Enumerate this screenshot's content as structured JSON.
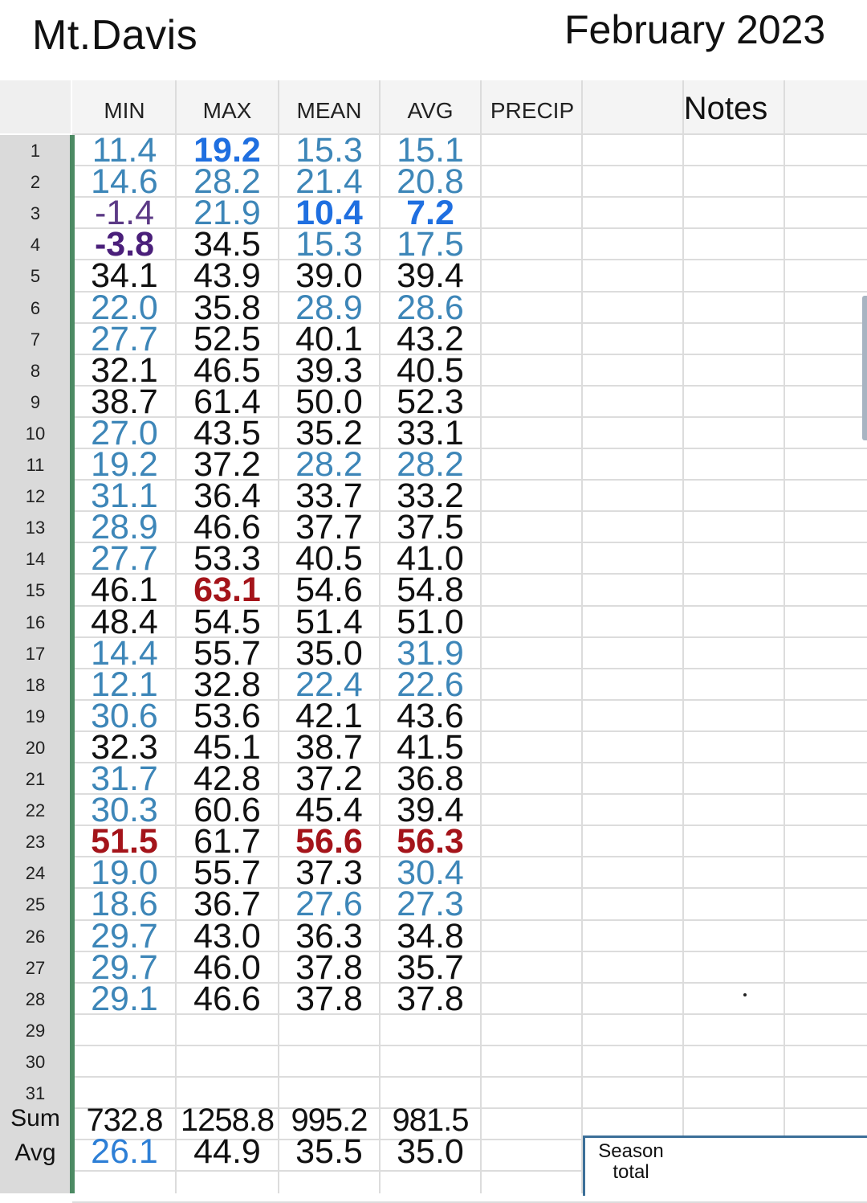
{
  "location": "Mt.Davis",
  "month": "February 2023",
  "columns": [
    "MIN",
    "MAX",
    "MEAN",
    "AVG",
    "PRECIP"
  ],
  "notes_header": "Notes",
  "row_numbers": [
    "1",
    "2",
    "3",
    "4",
    "5",
    "6",
    "7",
    "8",
    "9",
    "10",
    "11",
    "12",
    "13",
    "14",
    "15",
    "16",
    "17",
    "18",
    "19",
    "20",
    "21",
    "22",
    "23",
    "24",
    "25",
    "26",
    "27",
    "28",
    "29",
    "30",
    "31"
  ],
  "rows": [
    [
      [
        "11.4",
        "lblue"
      ],
      [
        "19.2",
        "bblue"
      ],
      [
        "15.3",
        "lblue"
      ],
      [
        "15.1",
        "lblue"
      ]
    ],
    [
      [
        "14.6",
        "lblue"
      ],
      [
        "28.2",
        "lblue"
      ],
      [
        "21.4",
        "lblue"
      ],
      [
        "20.8",
        "lblue"
      ]
    ],
    [
      [
        "-1.4",
        "lpurple"
      ],
      [
        "21.9",
        "lblue"
      ],
      [
        "10.4",
        "bblue"
      ],
      [
        "7.2",
        "bblue"
      ]
    ],
    [
      [
        "-3.8",
        "dpurple"
      ],
      [
        "34.5",
        "black"
      ],
      [
        "15.3",
        "lblue"
      ],
      [
        "17.5",
        "lblue"
      ]
    ],
    [
      [
        "34.1",
        "black"
      ],
      [
        "43.9",
        "black"
      ],
      [
        "39.0",
        "black"
      ],
      [
        "39.4",
        "black"
      ]
    ],
    [
      [
        "22.0",
        "lblue"
      ],
      [
        "35.8",
        "black"
      ],
      [
        "28.9",
        "lblue"
      ],
      [
        "28.6",
        "lblue"
      ]
    ],
    [
      [
        "27.7",
        "lblue"
      ],
      [
        "52.5",
        "black"
      ],
      [
        "40.1",
        "black"
      ],
      [
        "43.2",
        "black"
      ]
    ],
    [
      [
        "32.1",
        "black"
      ],
      [
        "46.5",
        "black"
      ],
      [
        "39.3",
        "black"
      ],
      [
        "40.5",
        "black"
      ]
    ],
    [
      [
        "38.7",
        "black"
      ],
      [
        "61.4",
        "black"
      ],
      [
        "50.0",
        "black"
      ],
      [
        "52.3",
        "black"
      ]
    ],
    [
      [
        "27.0",
        "lblue"
      ],
      [
        "43.5",
        "black"
      ],
      [
        "35.2",
        "black"
      ],
      [
        "33.1",
        "black"
      ]
    ],
    [
      [
        "19.2",
        "lblue"
      ],
      [
        "37.2",
        "black"
      ],
      [
        "28.2",
        "lblue"
      ],
      [
        "28.2",
        "lblue"
      ]
    ],
    [
      [
        "31.1",
        "lblue"
      ],
      [
        "36.4",
        "black"
      ],
      [
        "33.7",
        "black"
      ],
      [
        "33.2",
        "black"
      ]
    ],
    [
      [
        "28.9",
        "lblue"
      ],
      [
        "46.6",
        "black"
      ],
      [
        "37.7",
        "black"
      ],
      [
        "37.5",
        "black"
      ]
    ],
    [
      [
        "27.7",
        "lblue"
      ],
      [
        "53.3",
        "black"
      ],
      [
        "40.5",
        "black"
      ],
      [
        "41.0",
        "black"
      ]
    ],
    [
      [
        "46.1",
        "black"
      ],
      [
        "63.1",
        "red"
      ],
      [
        "54.6",
        "black"
      ],
      [
        "54.8",
        "black"
      ]
    ],
    [
      [
        "48.4",
        "black"
      ],
      [
        "54.5",
        "black"
      ],
      [
        "51.4",
        "black"
      ],
      [
        "51.0",
        "black"
      ]
    ],
    [
      [
        "14.4",
        "lblue"
      ],
      [
        "55.7",
        "black"
      ],
      [
        "35.0",
        "black"
      ],
      [
        "31.9",
        "lblue"
      ]
    ],
    [
      [
        "12.1",
        "lblue"
      ],
      [
        "32.8",
        "black"
      ],
      [
        "22.4",
        "lblue"
      ],
      [
        "22.6",
        "lblue"
      ]
    ],
    [
      [
        "30.6",
        "lblue"
      ],
      [
        "53.6",
        "black"
      ],
      [
        "42.1",
        "black"
      ],
      [
        "43.6",
        "black"
      ]
    ],
    [
      [
        "32.3",
        "black"
      ],
      [
        "45.1",
        "black"
      ],
      [
        "38.7",
        "black"
      ],
      [
        "41.5",
        "black"
      ]
    ],
    [
      [
        "31.7",
        "lblue"
      ],
      [
        "42.8",
        "black"
      ],
      [
        "37.2",
        "black"
      ],
      [
        "36.8",
        "black"
      ]
    ],
    [
      [
        "30.3",
        "lblue"
      ],
      [
        "60.6",
        "black"
      ],
      [
        "45.4",
        "black"
      ],
      [
        "39.4",
        "black"
      ]
    ],
    [
      [
        "51.5",
        "red"
      ],
      [
        "61.7",
        "black"
      ],
      [
        "56.6",
        "red"
      ],
      [
        "56.3",
        "red"
      ]
    ],
    [
      [
        "19.0",
        "lblue"
      ],
      [
        "55.7",
        "black"
      ],
      [
        "37.3",
        "black"
      ],
      [
        "30.4",
        "lblue"
      ]
    ],
    [
      [
        "18.6",
        "lblue"
      ],
      [
        "36.7",
        "black"
      ],
      [
        "27.6",
        "lblue"
      ],
      [
        "27.3",
        "lblue"
      ]
    ],
    [
      [
        "29.7",
        "lblue"
      ],
      [
        "43.0",
        "black"
      ],
      [
        "36.3",
        "black"
      ],
      [
        "34.8",
        "black"
      ]
    ],
    [
      [
        "29.7",
        "lblue"
      ],
      [
        "46.0",
        "black"
      ],
      [
        "37.8",
        "black"
      ],
      [
        "35.7",
        "black"
      ]
    ],
    [
      [
        "29.1",
        "lblue"
      ],
      [
        "46.6",
        "black"
      ],
      [
        "37.8",
        "black"
      ],
      [
        "37.8",
        "black"
      ]
    ]
  ],
  "sum_label": "Sum",
  "sum_values": [
    "732.8",
    "1258.8",
    "995.2",
    "981.5"
  ],
  "avg_label": "Avg",
  "avg_values": [
    [
      "26.1",
      "blue"
    ],
    [
      "44.9",
      "black"
    ],
    [
      "35.5",
      "black"
    ],
    [
      "35.0",
      "black"
    ]
  ],
  "season_label": "Season total"
}
